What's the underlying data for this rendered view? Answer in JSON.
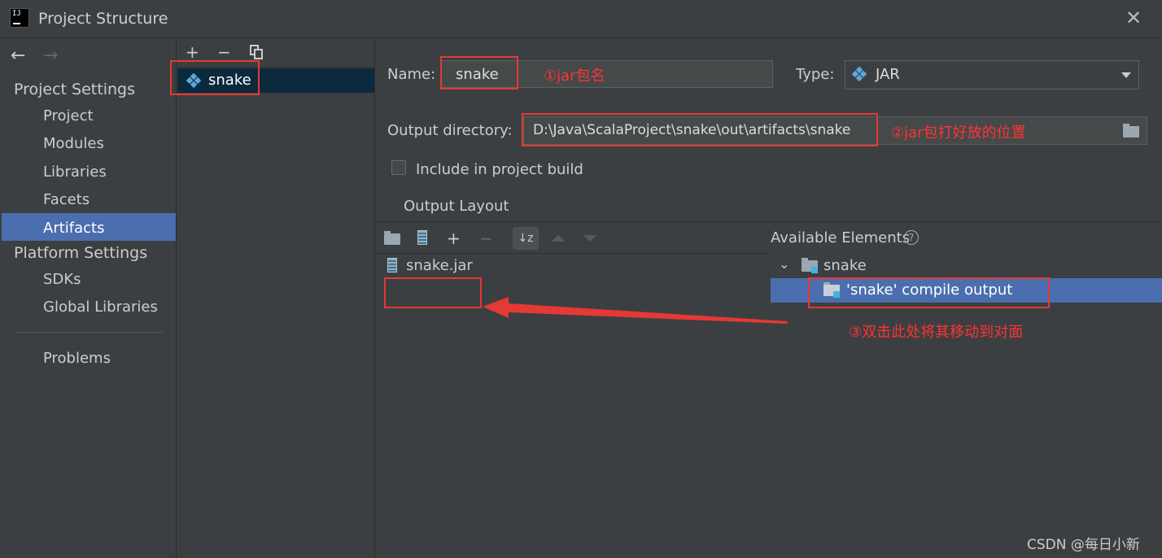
{
  "window": {
    "title": "Project Structure",
    "close_glyph": "✕"
  },
  "nav": {
    "back_glyph": "←",
    "forward_glyph": "→",
    "project_settings_header": "Project Settings",
    "project_settings_items": [
      "Project",
      "Modules",
      "Libraries",
      "Facets",
      "Artifacts"
    ],
    "platform_settings_header": "Platform Settings",
    "platform_settings_items": [
      "SDKs",
      "Global Libraries"
    ],
    "problems": "Problems",
    "selected": "Artifacts"
  },
  "artifact_list": {
    "add_glyph": "+",
    "remove_glyph": "−",
    "items": [
      "snake"
    ]
  },
  "form": {
    "name_label": "Name:",
    "name_value": "snake",
    "type_label": "Type:",
    "type_value": "JAR",
    "output_dir_label": "Output directory:",
    "output_dir_value": "D:\\Java\\ScalaProject\\snake\\out\\artifacts\\snake",
    "include_build_label": "Include in project build",
    "include_build_checked": false,
    "output_layout_tab": "Output Layout"
  },
  "layout_tree": {
    "root": "snake.jar"
  },
  "available": {
    "header": "Available Elements",
    "help_glyph": "?",
    "tree": {
      "root": "snake",
      "child": "'snake' compile output"
    }
  },
  "annotations": {
    "a1": "①jar包名",
    "a2": "②jar包打好放的位置",
    "a3": "③双击此处将其移动到对面"
  },
  "watermark": "CSDN @每日小新",
  "colors": {
    "selection": "#4b6eaf",
    "annotation": "#e53935",
    "background": "#3c3f41"
  }
}
